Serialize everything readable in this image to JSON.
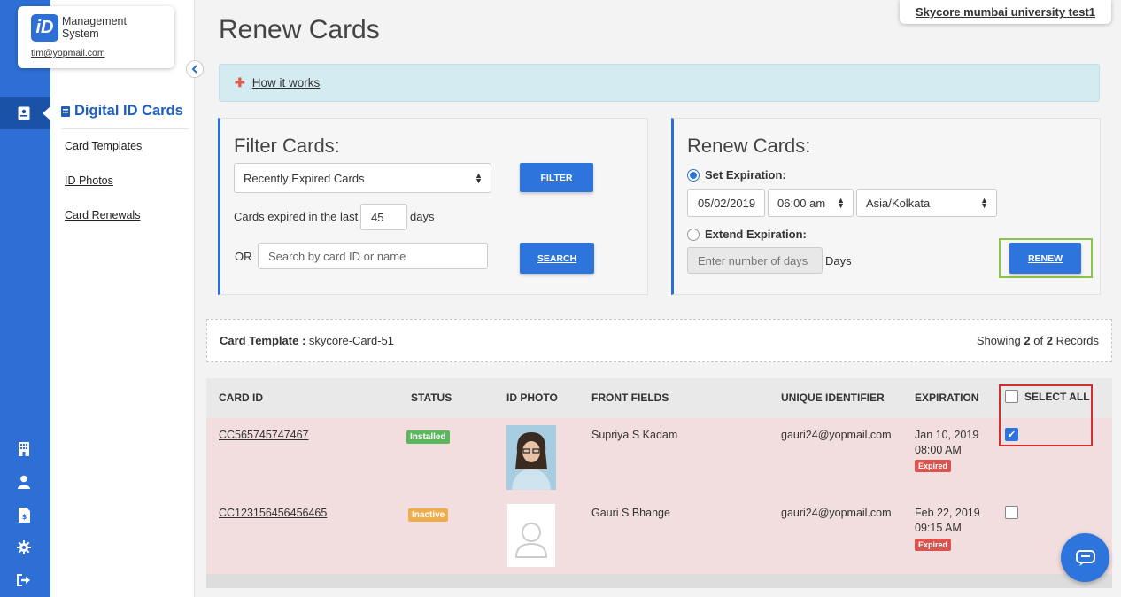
{
  "app": {
    "logo_mark": "iD",
    "logo_line1": "Management",
    "logo_line2": "System",
    "user_email": "tim@yopmail.com",
    "org_name": "Skycore mumbai university test1"
  },
  "sidebar": {
    "title": "Digital ID Cards",
    "items": [
      {
        "label": "Card Templates"
      },
      {
        "label": "ID Photos"
      },
      {
        "label": "Card Renewals"
      }
    ]
  },
  "page": {
    "title": "Renew Cards",
    "how_it_works": "How it works"
  },
  "filter": {
    "title": "Filter Cards:",
    "select_value": "Recently Expired Cards",
    "filter_button": "FILTER",
    "expired_label": "Cards expired in the last",
    "days_value": "45",
    "days_label": "days",
    "or_label": "OR",
    "search_placeholder": "Search by card ID or name",
    "search_button": "SEARCH"
  },
  "renew": {
    "title": "Renew Cards:",
    "set_expiration_label": "Set Expiration:",
    "date_value": "05/02/2019",
    "time_value": "06:00 am",
    "timezone_value": "Asia/Kolkata",
    "extend_expiration_label": "Extend Expiration:",
    "days_placeholder": "Enter number of days",
    "days_suffix": "Days",
    "renew_button": "RENEW"
  },
  "template_bar": {
    "label": "Card Template :",
    "value": "skycore-Card-51",
    "showing_prefix": "Showing",
    "showing_count": "2",
    "showing_of": "of",
    "showing_total": "2",
    "showing_suffix": "Records"
  },
  "table": {
    "headers": {
      "card_id": "CARD ID",
      "status": "STATUS",
      "id_photo": "ID PHOTO",
      "front_fields": "FRONT FIELDS",
      "unique_identifier": "UNIQUE IDENTIFIER",
      "expiration": "EXPIRATION",
      "select_all": "SELECT ALL"
    },
    "rows": [
      {
        "card_id": "CC565745747467",
        "status": "Installed",
        "front_fields": "Supriya S Kadam",
        "unique_identifier": "gauri24@yopmail.com",
        "exp_date": "Jan 10, 2019",
        "exp_time": "08:00 AM",
        "exp_badge": "Expired",
        "selected": true
      },
      {
        "card_id": "CC123156456456465",
        "status": "Inactive",
        "front_fields": "Gauri S Bhange",
        "unique_identifier": "gauri24@yopmail.com",
        "exp_date": "Feb 22, 2019",
        "exp_time": "09:15 AM",
        "exp_badge": "Expired",
        "selected": false
      }
    ]
  },
  "colors": {
    "primary": "#2d6fd4",
    "installed": "#5cb85c",
    "inactive": "#f0ad4e",
    "expired": "#d9534f",
    "row_bg": "#f2dede"
  }
}
